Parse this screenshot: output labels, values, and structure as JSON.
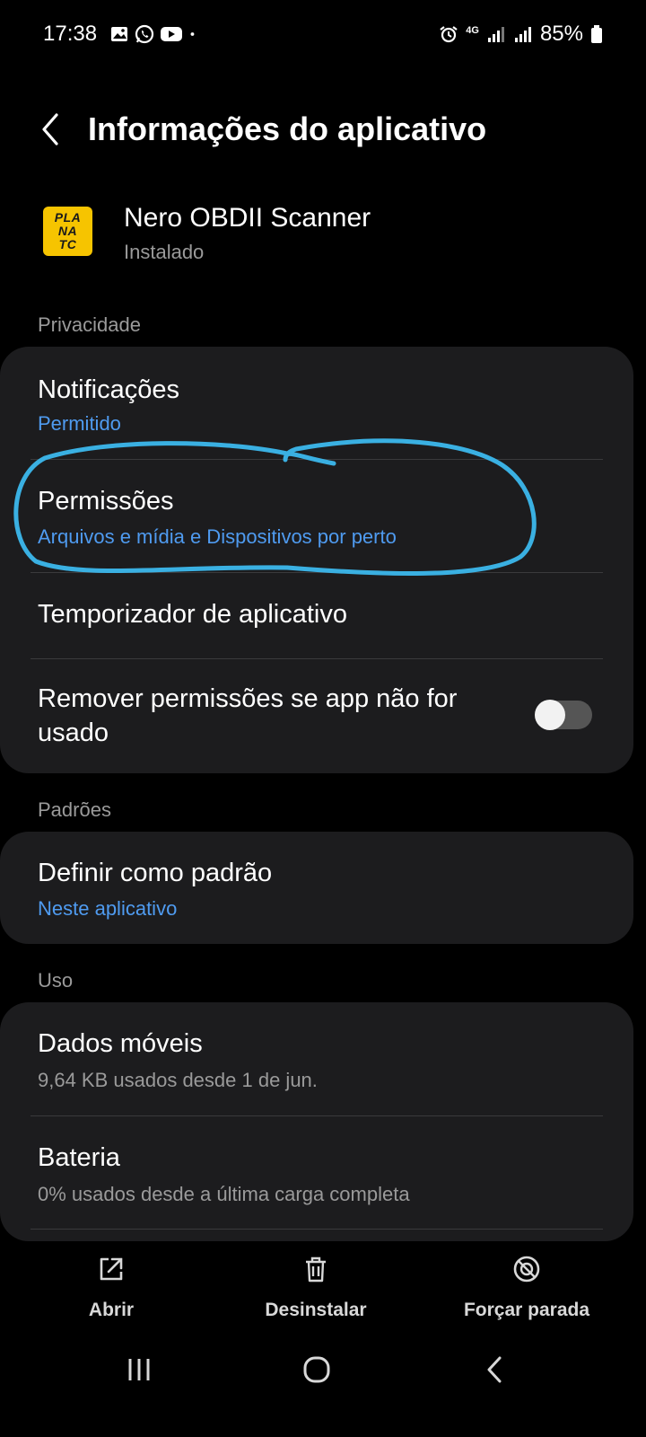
{
  "status_bar": {
    "time": "17:38",
    "battery": "85%",
    "network": "4G",
    "icons": [
      "gallery-icon",
      "whatsapp-icon",
      "youtube-icon",
      "dot-icon",
      "alarm-icon",
      "signal-icon",
      "battery-icon"
    ]
  },
  "header": {
    "title": "Informações do aplicativo"
  },
  "app": {
    "name": "Nero OBDII Scanner",
    "status": "Instalado",
    "icon_lines": [
      "PLA",
      "NA",
      "TC"
    ],
    "icon_color": "#f6c400"
  },
  "privacy": {
    "label": "Privacidade",
    "notifications": {
      "title": "Notificações",
      "value": "Permitido"
    },
    "permissions": {
      "title": "Permissões",
      "value": "Arquivos e mídia e Dispositivos por perto"
    },
    "app_timer": {
      "title": "Temporizador de aplicativo"
    },
    "remove_permissions": {
      "line1": "Remover permissões se app não for",
      "line2": "usado",
      "enabled": false
    }
  },
  "defaults": {
    "label": "Padrões",
    "set_default": {
      "title": "Definir como padrão",
      "value": "Neste aplicativo"
    }
  },
  "usage": {
    "label": "Uso",
    "mobile_data": {
      "title": "Dados móveis",
      "value": "9,64 KB usados desde 1 de jun."
    },
    "battery": {
      "title": "Bateria",
      "value": "0% usados desde a última carga completa"
    }
  },
  "actions": {
    "open": "Abrir",
    "uninstall": "Desinstalar",
    "force_stop": "Forçar parada"
  },
  "colors": {
    "accent": "#4f9bf0",
    "card": "#1c1c1e",
    "annotation": "#3ab0e2"
  }
}
